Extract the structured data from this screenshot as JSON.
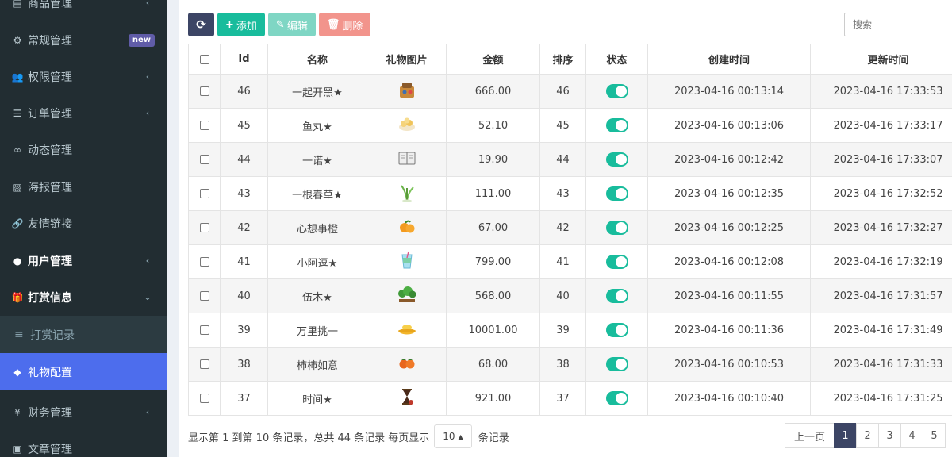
{
  "sidebar": {
    "items": [
      {
        "label": "商品管理",
        "icon": "book-icon",
        "glyph": "▤",
        "caret": "‹"
      },
      {
        "label": "常规管理",
        "icon": "cogs-icon",
        "glyph": "⚙",
        "badge": "new"
      },
      {
        "label": "权限管理",
        "icon": "users-icon",
        "glyph": "👥",
        "caret": "‹"
      },
      {
        "label": "订单管理",
        "icon": "list-icon",
        "glyph": "☰",
        "caret": "‹"
      },
      {
        "label": "动态管理",
        "icon": "glasses-icon",
        "glyph": "∞"
      },
      {
        "label": "海报管理",
        "icon": "image-icon",
        "glyph": "▨"
      },
      {
        "label": "友情链接",
        "icon": "link-icon",
        "glyph": "🔗"
      },
      {
        "label": "用户管理",
        "icon": "user-circle-icon",
        "glyph": "●",
        "caret": "‹"
      },
      {
        "label": "打赏信息",
        "icon": "gift-icon",
        "glyph": "🎁",
        "caret": "⌄"
      }
    ],
    "submenu": {
      "label": "打赏记录",
      "icon": "list-lines-icon",
      "glyph": "≡"
    },
    "active": {
      "label": "礼物配置",
      "icon": "cube-icon",
      "glyph": "◆"
    },
    "after": [
      {
        "label": "财务管理",
        "icon": "yen-icon",
        "glyph": "¥",
        "caret": "‹"
      },
      {
        "label": "文章管理",
        "icon": "article-icon",
        "glyph": "▣"
      }
    ]
  },
  "toolbar": {
    "refresh_icon": "⟳",
    "add_label": "添加",
    "edit_label": "编辑",
    "delete_label": "删除"
  },
  "search": {
    "placeholder": "搜索"
  },
  "table": {
    "columns": [
      "Id",
      "名称",
      "礼物图片",
      "金额",
      "排序",
      "状态",
      "创建时间",
      "更新时间"
    ],
    "rows": [
      {
        "id": "46",
        "name": "一起开黑★",
        "image": "game-bag-gift-icon",
        "amount": "666.00",
        "sort": "46",
        "status": "on",
        "created": "2023-04-16 00:13:14",
        "updated": "2023-04-16 17:33:53"
      },
      {
        "id": "45",
        "name": "鱼丸★",
        "image": "fishball-gift-icon",
        "amount": "52.10",
        "sort": "45",
        "status": "on",
        "created": "2023-04-16 00:13:06",
        "updated": "2023-04-16 17:33:17"
      },
      {
        "id": "44",
        "name": "一诺★",
        "image": "book-gift-icon",
        "amount": "19.90",
        "sort": "44",
        "status": "on",
        "created": "2023-04-16 00:12:42",
        "updated": "2023-04-16 17:33:07"
      },
      {
        "id": "43",
        "name": "一根春草★",
        "image": "grass-gift-icon",
        "amount": "111.00",
        "sort": "43",
        "status": "on",
        "created": "2023-04-16 00:12:35",
        "updated": "2023-04-16 17:32:52"
      },
      {
        "id": "42",
        "name": "心想事橙",
        "image": "orange-gift-icon",
        "amount": "67.00",
        "sort": "42",
        "status": "on",
        "created": "2023-04-16 00:12:25",
        "updated": "2023-04-16 17:32:27"
      },
      {
        "id": "41",
        "name": "小阿逗★",
        "image": "drink-gift-icon",
        "amount": "799.00",
        "sort": "41",
        "status": "on",
        "created": "2023-04-16 00:12:08",
        "updated": "2023-04-16 17:32:19"
      },
      {
        "id": "40",
        "name": "伍木★",
        "image": "trees-gift-icon",
        "amount": "568.00",
        "sort": "40",
        "status": "on",
        "created": "2023-04-16 00:11:55",
        "updated": "2023-04-16 17:31:57"
      },
      {
        "id": "39",
        "name": "万里挑一",
        "image": "gold-ingot-gift-icon",
        "amount": "10001.00",
        "sort": "39",
        "status": "on",
        "created": "2023-04-16 00:11:36",
        "updated": "2023-04-16 17:31:49"
      },
      {
        "id": "38",
        "name": "柿柿如意",
        "image": "persimmon-gift-icon",
        "amount": "68.00",
        "sort": "38",
        "status": "on",
        "created": "2023-04-16 00:10:53",
        "updated": "2023-04-16 17:31:33"
      },
      {
        "id": "37",
        "name": "时间★",
        "image": "hourglass-gift-icon",
        "amount": "921.00",
        "sort": "37",
        "status": "on",
        "created": "2023-04-16 00:10:40",
        "updated": "2023-04-16 17:31:25"
      }
    ]
  },
  "footer": {
    "info": "显示第 1 到第 10 条记录，总共 44 条记录 每页显示",
    "pagesize": "10",
    "suffix": "条记录"
  },
  "pager": {
    "prev": "上一页",
    "pages": [
      "1",
      "2",
      "3",
      "4",
      "5"
    ],
    "current": "1"
  },
  "colors": {
    "sidebar_bg": "#222d32",
    "active_bg": "#4d6ded",
    "teal": "#18bc9c",
    "navy": "#3c4565"
  }
}
